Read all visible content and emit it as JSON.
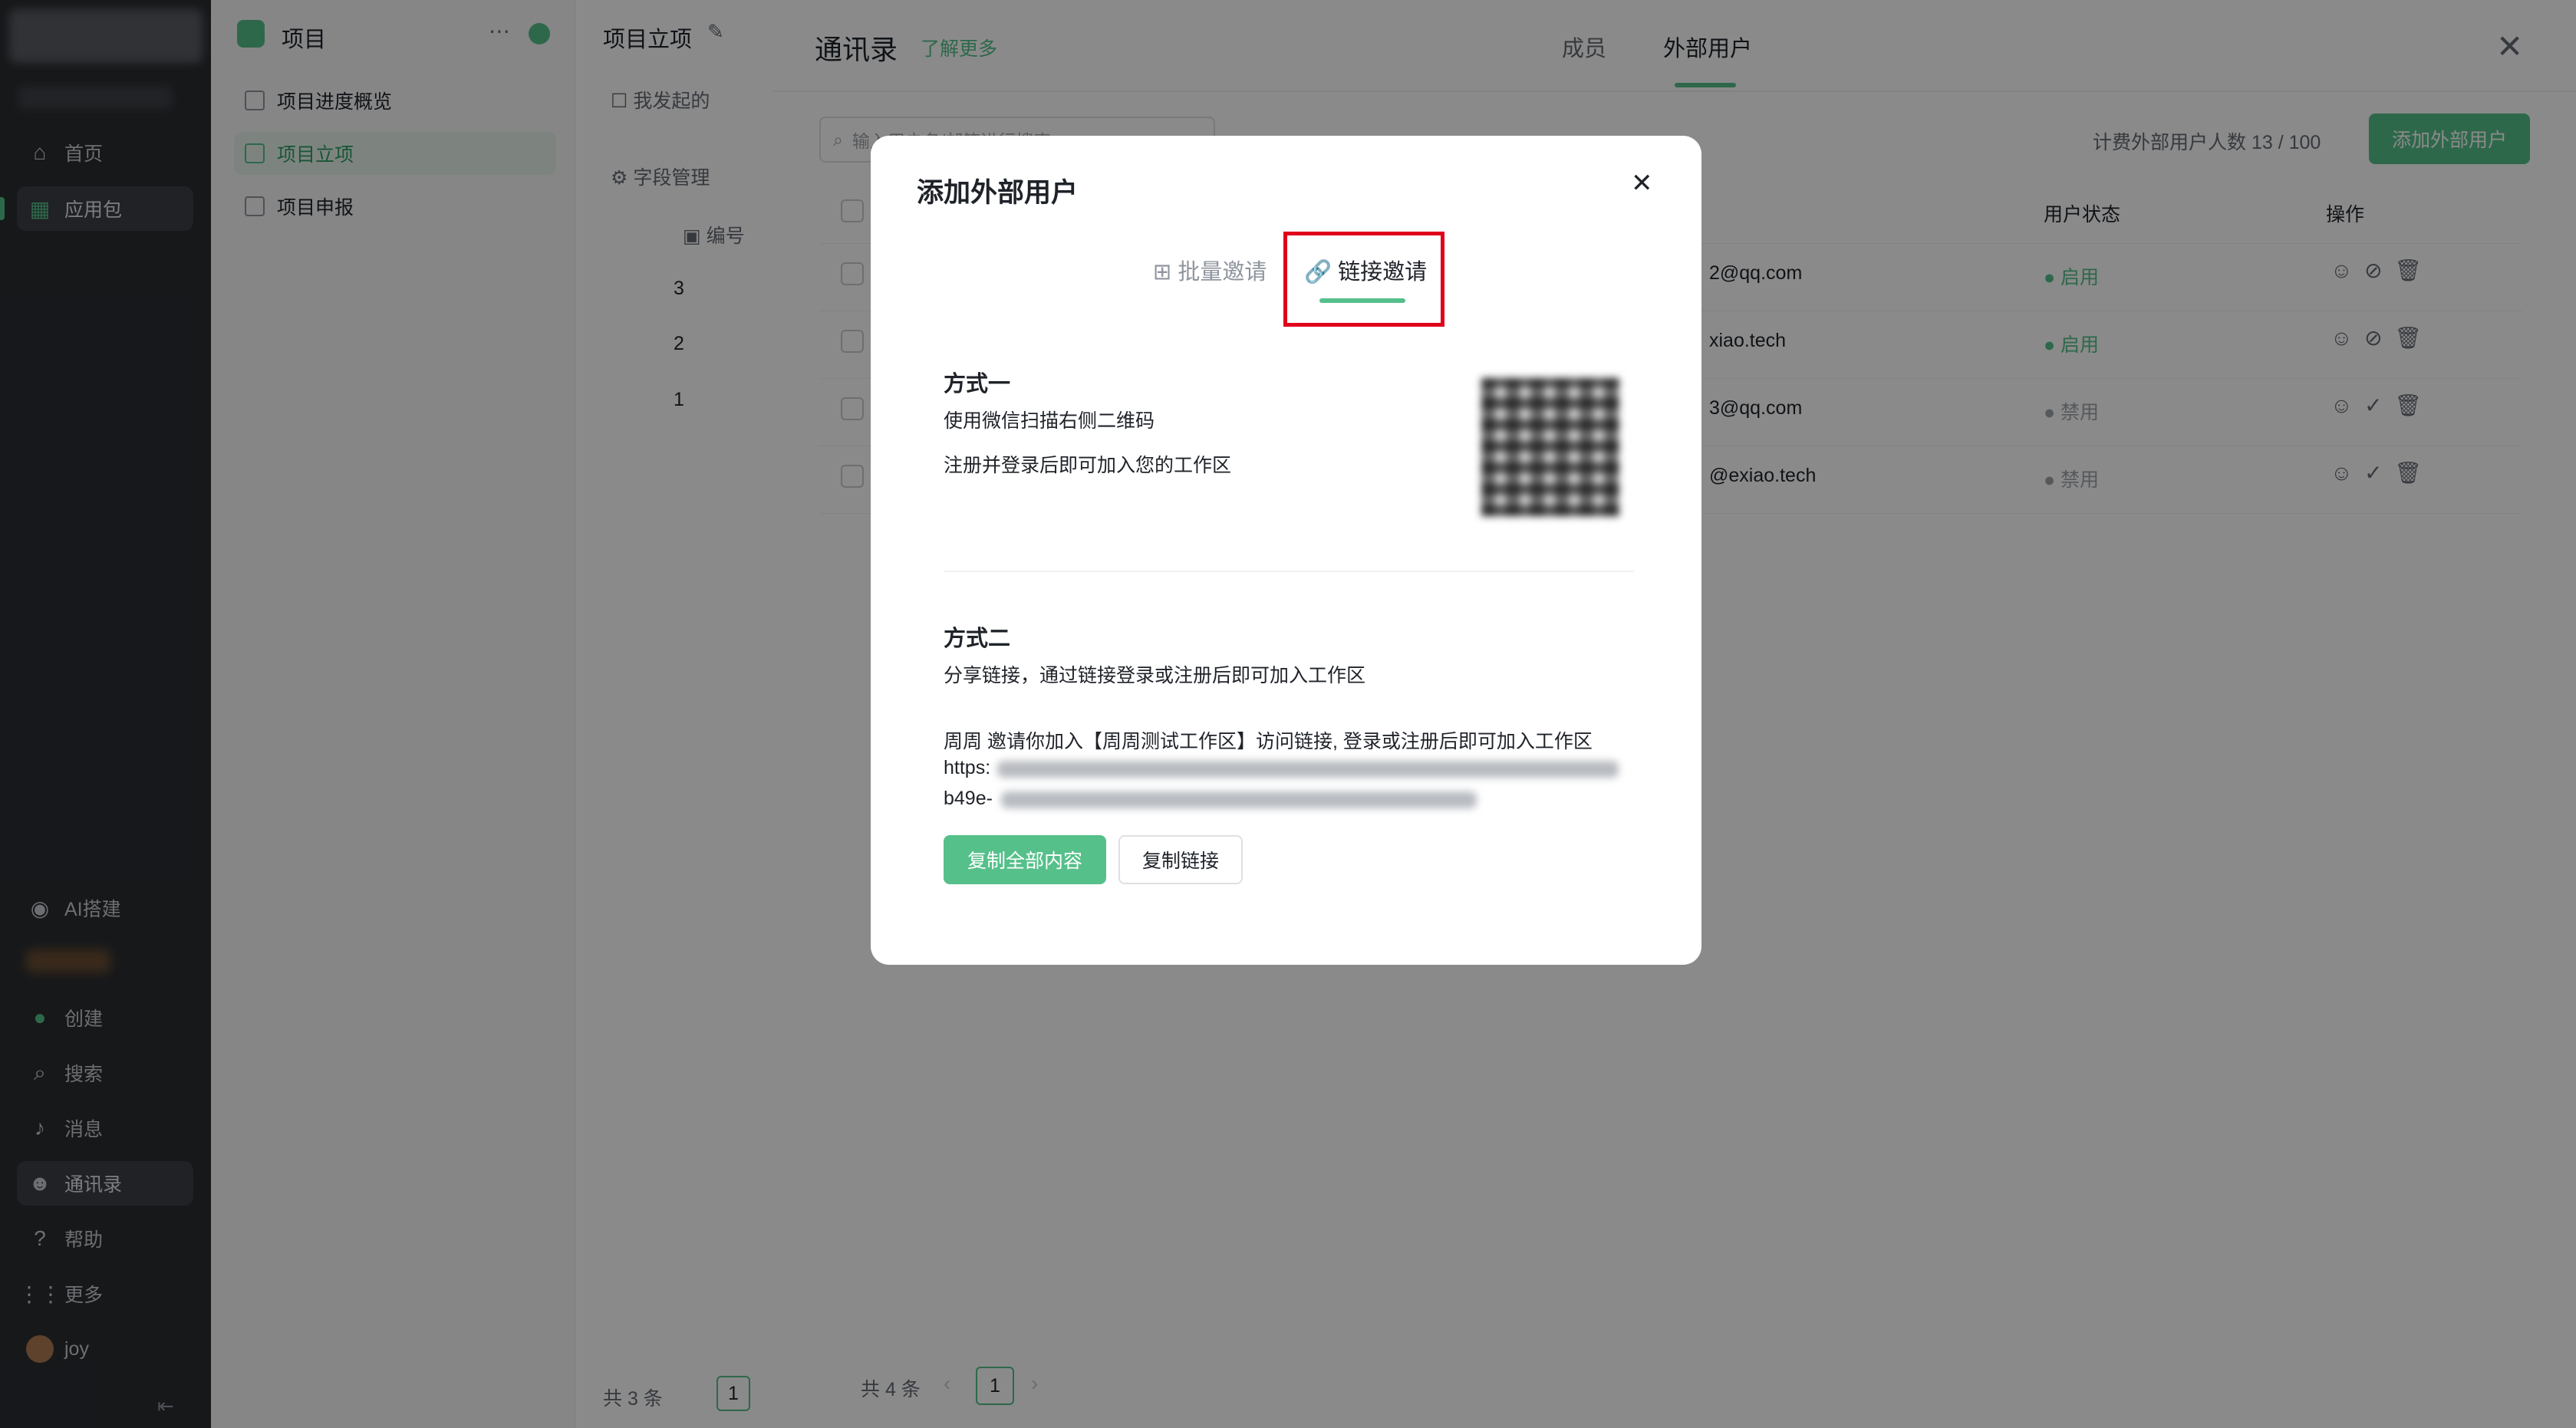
{
  "nav": {
    "items": [
      {
        "label": "首页",
        "icon": "home-icon"
      },
      {
        "label": "应用包",
        "icon": "apps-icon"
      }
    ],
    "bottom_items": [
      {
        "label": "AI搭建",
        "icon": "ai-icon"
      },
      {
        "label": "创建",
        "icon": "create-icon"
      },
      {
        "label": "搜索",
        "icon": "search-icon"
      },
      {
        "label": "消息",
        "icon": "bell-icon"
      },
      {
        "label": "通讯录",
        "icon": "contacts-icon"
      },
      {
        "label": "帮助",
        "icon": "help-icon"
      },
      {
        "label": "更多",
        "icon": "grid-icon"
      }
    ],
    "user": "joy"
  },
  "project": {
    "title": "项目",
    "items": [
      "项目进度概览",
      "项目立项",
      "项目申报"
    ]
  },
  "col3": {
    "title": "项目立项",
    "filter": "我发起的",
    "field_mgmt": "字段管理",
    "col_header": "编号",
    "rows": [
      "3",
      "2",
      "1"
    ],
    "footer": "共 3 条",
    "page": "1"
  },
  "drawer": {
    "title": "通讯录",
    "learn_more": "了解更多",
    "tabs": [
      "成员",
      "外部用户"
    ],
    "search_placeholder": "输入用户名/邮箱进行搜索",
    "quota": "计费外部用户人数 13 / 100",
    "add_button": "添加外部用户",
    "headers": {
      "status": "用户状态",
      "ops": "操作"
    },
    "rows": [
      {
        "email": "2@qq.com",
        "status": "启用"
      },
      {
        "email": "xiao.tech",
        "status": "启用"
      },
      {
        "email": "3@qq.com",
        "status": "禁用"
      },
      {
        "email": "@exiao.tech",
        "status": "禁用"
      }
    ],
    "footer": "共 4 条",
    "page": "1"
  },
  "modal": {
    "title": "添加外部用户",
    "tabs": [
      "批量邀请",
      "链接邀请"
    ],
    "method1": {
      "title": "方式一",
      "line1": "使用微信扫描右侧二维码",
      "line2": "注册并登录后即可加入您的工作区"
    },
    "method2": {
      "title": "方式二",
      "desc": "分享链接，通过链接登录或注册后即可加入工作区",
      "invite": "周周 邀请你加入【周周测试工作区】访问链接, 登录或注册后即可加入工作区",
      "link_prefix1": "https:",
      "link_prefix2": "b49e-"
    },
    "copy_all": "复制全部内容",
    "copy_link": "复制链接"
  },
  "colors": {
    "accent": "#56c08a",
    "highlight": "#e0001b"
  }
}
